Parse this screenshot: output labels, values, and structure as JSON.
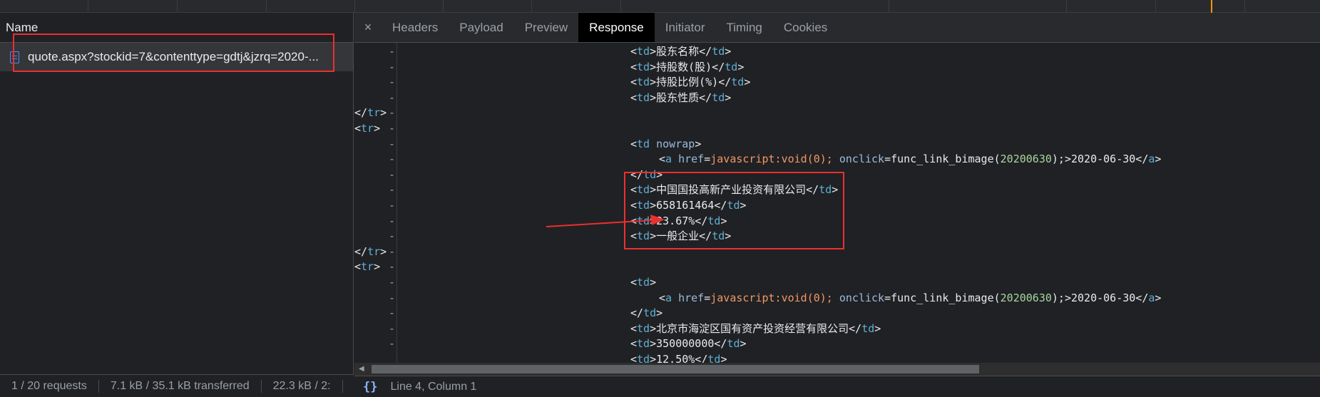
{
  "network": {
    "column_name": "Name",
    "requests": [
      {
        "name": "quote.aspx?stockid=7&contenttype=gdtj&jzrq=2020-...",
        "icon": "document-icon"
      }
    ],
    "status": {
      "requests": "1 / 20 requests",
      "transferred": "7.1 kB / 35.1 kB transferred",
      "resources": "22.3 kB / 2:"
    }
  },
  "details": {
    "tabs": [
      "Headers",
      "Payload",
      "Preview",
      "Response",
      "Initiator",
      "Timing",
      "Cookies"
    ],
    "active_tab": "Response",
    "close_glyph": "×",
    "footer": {
      "brace": "{}",
      "position": "Line 4, Column 1"
    }
  },
  "response_lines": [
    {
      "marker": "-",
      "indent": 2,
      "parts": [
        [
          "punct",
          "<"
        ],
        [
          "tag",
          "td"
        ],
        [
          "punct",
          ">股东名称</"
        ],
        [
          "tag",
          "td"
        ],
        [
          "punct",
          ">"
        ]
      ]
    },
    {
      "marker": "-",
      "indent": 2,
      "parts": [
        [
          "punct",
          "<"
        ],
        [
          "tag",
          "td"
        ],
        [
          "punct",
          ">持股数(股)</"
        ],
        [
          "tag",
          "td"
        ],
        [
          "punct",
          ">"
        ]
      ]
    },
    {
      "marker": "-",
      "indent": 2,
      "parts": [
        [
          "punct",
          "<"
        ],
        [
          "tag",
          "td"
        ],
        [
          "punct",
          ">持股比例(%)</"
        ],
        [
          "tag",
          "td"
        ],
        [
          "punct",
          ">"
        ]
      ]
    },
    {
      "marker": "-",
      "indent": 2,
      "parts": [
        [
          "punct",
          "<"
        ],
        [
          "tag",
          "td"
        ],
        [
          "punct",
          ">股东性质</"
        ],
        [
          "tag",
          "td"
        ],
        [
          "punct",
          ">"
        ]
      ]
    },
    {
      "marker": "-",
      "indent": 1,
      "parts": [
        [
          "punct",
          "</"
        ],
        [
          "tag",
          "tr"
        ],
        [
          "punct",
          ">"
        ]
      ]
    },
    {
      "marker": "-",
      "indent": 1,
      "parts": [
        [
          "punct",
          "<"
        ],
        [
          "tag",
          "tr"
        ],
        [
          "punct",
          ">"
        ]
      ]
    },
    {
      "marker": "-",
      "indent": 2,
      "parts": [
        [
          "punct",
          "<"
        ],
        [
          "tag",
          "td"
        ],
        [
          "punct",
          " "
        ],
        [
          "attr",
          "nowrap"
        ],
        [
          "punct",
          ">"
        ]
      ]
    },
    {
      "marker": "-",
      "indent": 3,
      "parts": [
        [
          "punct",
          "<"
        ],
        [
          "tag",
          "a"
        ],
        [
          "punct",
          " "
        ],
        [
          "attr",
          "href"
        ],
        [
          "punct",
          "="
        ],
        [
          "val",
          "javascript:void(0);"
        ],
        [
          "punct",
          " "
        ],
        [
          "attr",
          "onclick"
        ],
        [
          "punct",
          "=func_link_bimage("
        ],
        [
          "num",
          "20200630"
        ],
        [
          "punct",
          ");>2020-06-30</"
        ],
        [
          "tag",
          "a"
        ],
        [
          "punct",
          ">"
        ]
      ]
    },
    {
      "marker": "-",
      "indent": 2,
      "parts": [
        [
          "punct",
          "</"
        ],
        [
          "tag",
          "td"
        ],
        [
          "punct",
          ">"
        ]
      ]
    },
    {
      "marker": "-",
      "indent": 2,
      "parts": [
        [
          "punct",
          "<"
        ],
        [
          "tag",
          "td"
        ],
        [
          "punct",
          ">中国国投高新产业投资有限公司</"
        ],
        [
          "tag",
          "td"
        ],
        [
          "punct",
          ">"
        ]
      ]
    },
    {
      "marker": "-",
      "indent": 2,
      "parts": [
        [
          "punct",
          "<"
        ],
        [
          "tag",
          "td"
        ],
        [
          "punct",
          ">658161464</"
        ],
        [
          "tag",
          "td"
        ],
        [
          "punct",
          ">"
        ]
      ]
    },
    {
      "marker": "-",
      "indent": 2,
      "parts": [
        [
          "punct",
          "<"
        ],
        [
          "tag",
          "td"
        ],
        [
          "punct",
          ">23.67%</"
        ],
        [
          "tag",
          "td"
        ],
        [
          "punct",
          ">"
        ]
      ]
    },
    {
      "marker": "-",
      "indent": 2,
      "parts": [
        [
          "punct",
          "<"
        ],
        [
          "tag",
          "td"
        ],
        [
          "punct",
          ">一般企业</"
        ],
        [
          "tag",
          "td"
        ],
        [
          "punct",
          ">"
        ]
      ]
    },
    {
      "marker": "-",
      "indent": 1,
      "parts": [
        [
          "punct",
          "</"
        ],
        [
          "tag",
          "tr"
        ],
        [
          "punct",
          ">"
        ]
      ]
    },
    {
      "marker": "-",
      "indent": 1,
      "parts": [
        [
          "punct",
          "<"
        ],
        [
          "tag",
          "tr"
        ],
        [
          "punct",
          ">"
        ]
      ]
    },
    {
      "marker": "-",
      "indent": 2,
      "parts": [
        [
          "punct",
          "<"
        ],
        [
          "tag",
          "td"
        ],
        [
          "punct",
          ">"
        ]
      ]
    },
    {
      "marker": "-",
      "indent": 3,
      "parts": [
        [
          "punct",
          "<"
        ],
        [
          "tag",
          "a"
        ],
        [
          "punct",
          " "
        ],
        [
          "attr",
          "href"
        ],
        [
          "punct",
          "="
        ],
        [
          "val",
          "javascript:void(0);"
        ],
        [
          "punct",
          " "
        ],
        [
          "attr",
          "onclick"
        ],
        [
          "punct",
          "=func_link_bimage("
        ],
        [
          "num",
          "20200630"
        ],
        [
          "punct",
          ");>2020-06-30</"
        ],
        [
          "tag",
          "a"
        ],
        [
          "punct",
          ">"
        ]
      ]
    },
    {
      "marker": "-",
      "indent": 2,
      "parts": [
        [
          "punct",
          "</"
        ],
        [
          "tag",
          "td"
        ],
        [
          "punct",
          ">"
        ]
      ]
    },
    {
      "marker": "-",
      "indent": 2,
      "parts": [
        [
          "punct",
          "<"
        ],
        [
          "tag",
          "td"
        ],
        [
          "punct",
          ">北京市海淀区国有资产投资经营有限公司</"
        ],
        [
          "tag",
          "td"
        ],
        [
          "punct",
          ">"
        ]
      ]
    },
    {
      "marker": "-",
      "indent": 2,
      "parts": [
        [
          "punct",
          "<"
        ],
        [
          "tag",
          "td"
        ],
        [
          "punct",
          ">350000000</"
        ],
        [
          "tag",
          "td"
        ],
        [
          "punct",
          ">"
        ]
      ]
    },
    {
      "marker": "",
      "indent": 2,
      "parts": [
        [
          "punct",
          "<"
        ],
        [
          "tag",
          "td"
        ],
        [
          "punct",
          ">12.50%</"
        ],
        [
          "tag",
          "td"
        ],
        [
          "punct",
          ">"
        ]
      ]
    }
  ],
  "colors": {
    "highlight": "#ec2f2f",
    "active_tab_bg": "#000000",
    "tag": "#5db0d7",
    "attribute": "#9bbbdc",
    "string_value": "#f29766",
    "number": "#a8d6a0"
  }
}
